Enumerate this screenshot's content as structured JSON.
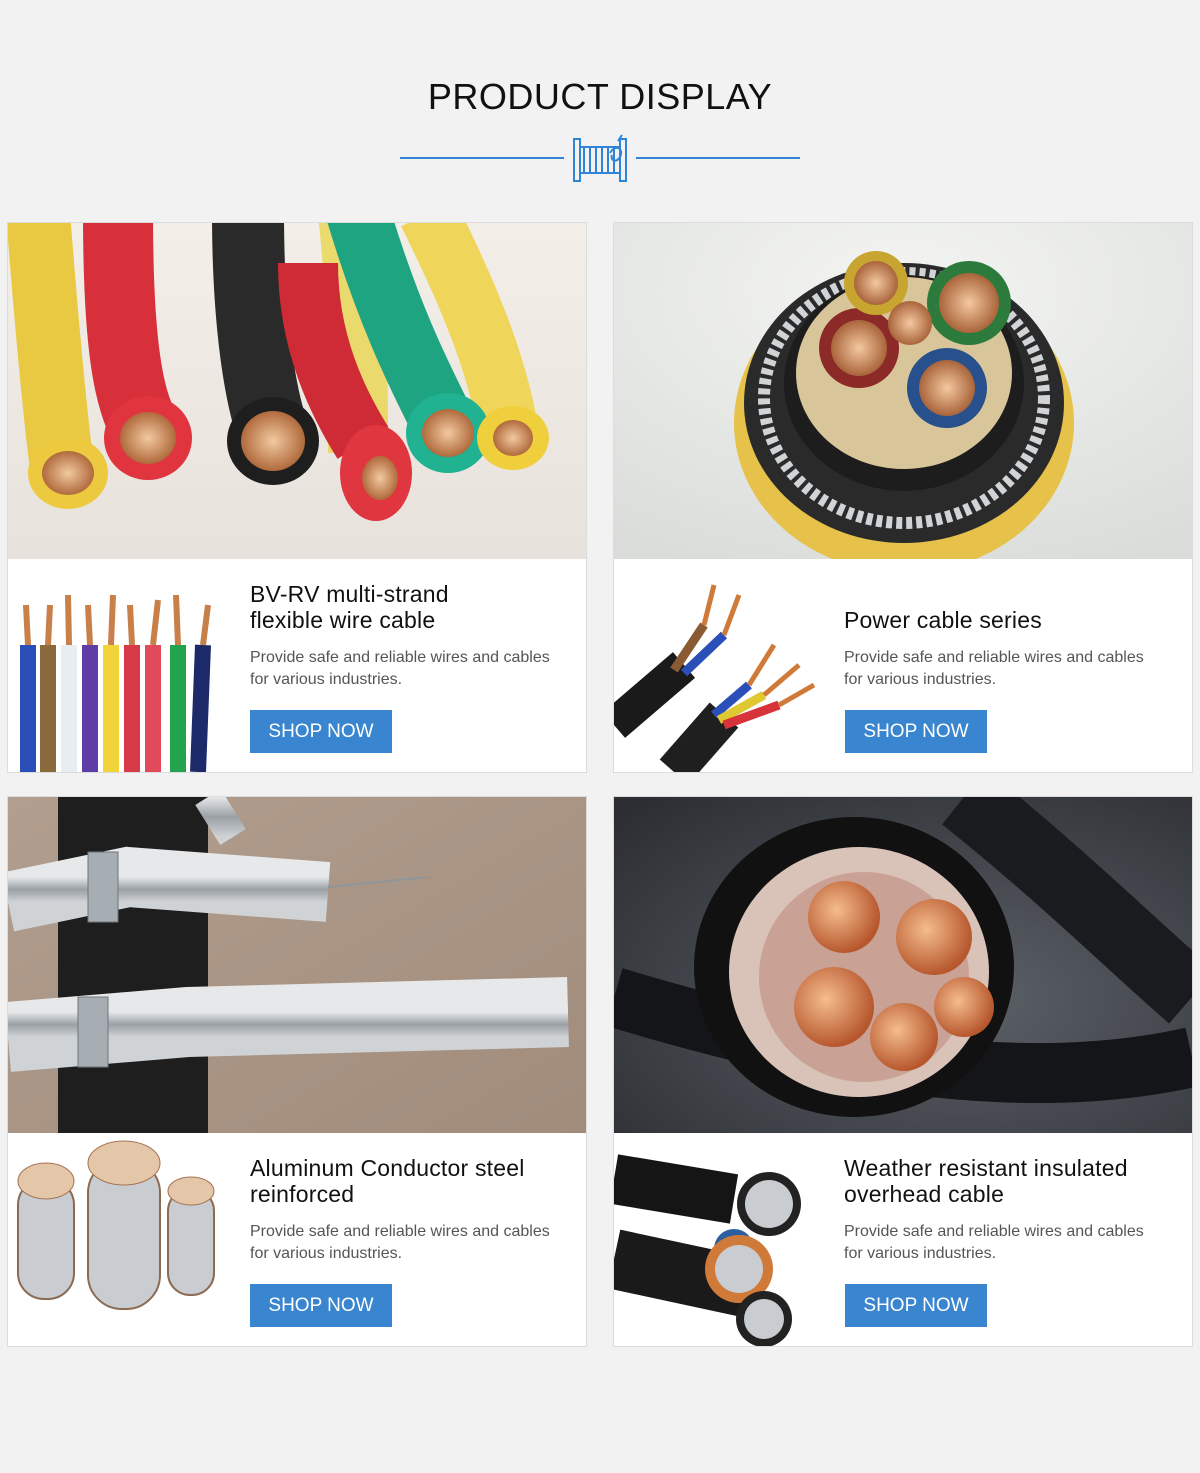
{
  "page": {
    "title": "PRODUCT DISPLAY",
    "accent_color": "#2f84d8",
    "divider_icon": "cable-reel-icon"
  },
  "products": [
    {
      "title_line1": "BV-RV multi-strand",
      "title_line2": "flexible wire cable",
      "description": "Provide safe and reliable wires and cables for various industries.",
      "button": "SHOP NOW"
    },
    {
      "title_line1": "Power cable series",
      "title_line2": "",
      "description": "Provide safe and reliable wires and cables for various industries.",
      "button": "SHOP NOW"
    },
    {
      "title_line1": "Aluminum Conductor steel",
      "title_line2": "reinforced",
      "description": "Provide safe and reliable wires and cables for various industries.",
      "button": "SHOP NOW"
    },
    {
      "title_line1": "Weather resistant insulated",
      "title_line2": "overhead cable",
      "description": "Provide safe and reliable wires and cables for various industries.",
      "button": "SHOP NOW"
    }
  ],
  "button_color": "#3a85cf"
}
